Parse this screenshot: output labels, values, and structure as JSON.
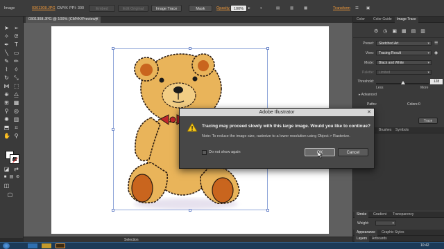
{
  "control_bar": {
    "image_label": "Image",
    "filename": "0301308.JPG",
    "color_mode": "CMYK",
    "ppi": "PPI: 300",
    "embed_label": "Embed",
    "edit_original_label": "Edit Original",
    "image_trace_label": "Image Trace",
    "mask_label": "Mask",
    "opacity_label": "Opacity:",
    "opacity_value": "100%",
    "transform_label": "Transform"
  },
  "document": {
    "tab_title": "0301308.JPG @ 100% (CMYK/Preview)"
  },
  "status_bar": {
    "tool_name": "Selection"
  },
  "right_panel": {
    "tabs": [
      "Color",
      "Color Guide",
      "Image Trace"
    ],
    "preset_label": "Preset:",
    "preset_value": "Sketched Art",
    "view_label": "View:",
    "view_value": "Tracing Result",
    "mode_label": "Mode:",
    "mode_value": "Black and White",
    "palette_label": "Palette:",
    "palette_value": "Limited",
    "threshold_label": "Threshold:",
    "threshold_value": "128",
    "less_label": "Less",
    "more_label": "More",
    "advanced_label": "Advanced",
    "paths_label": "Paths:",
    "colors_label": "Colors:",
    "colors_value": "0",
    "trace_button": "Trace",
    "mid_tabs": [
      "Brushes",
      "Symbols"
    ],
    "stroke_tabs": [
      "Stroke",
      "Gradient",
      "Transparency"
    ],
    "weight_label": "Weight:",
    "appearance_tabs": [
      "Appearance",
      "Graphic Styles"
    ],
    "layers_tabs": [
      "Layers",
      "Artboards"
    ]
  },
  "dialog": {
    "title": "Adobe Illustrator",
    "message": "Tracing may proceed slowly with this large image. Would you like to continue?",
    "note": "Note: To reduce the image size, rasterize to a lower resolution using Object > Rasterize.",
    "checkbox_label": "Do not show again",
    "ok_label": "OK",
    "cancel_label": "Cancel"
  },
  "taskbar": {
    "clock": "10:42"
  },
  "colors": {
    "accent_orange": "#f29a3a",
    "bear_fur": "#e9b45a",
    "bear_paw": "#c9651e",
    "bow_red": "#c0262b",
    "selection_blue": "#8fa6d9"
  }
}
